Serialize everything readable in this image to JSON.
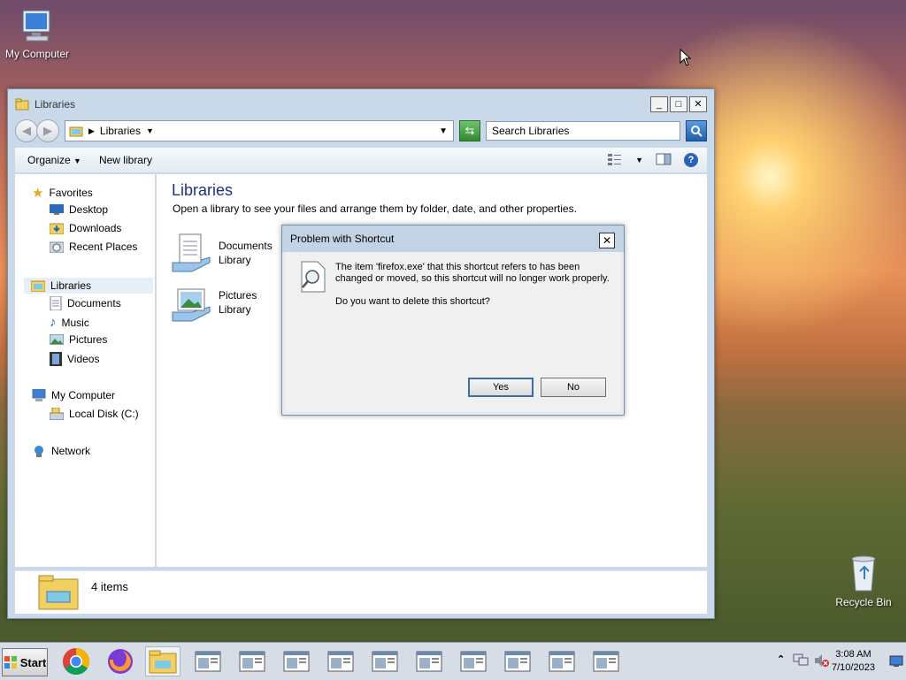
{
  "desktop": {
    "icons": [
      {
        "label": "My Computer"
      },
      {
        "label": "Recycle Bin"
      }
    ]
  },
  "explorer": {
    "title": "Libraries",
    "address": "Libraries",
    "search_placeholder": "Search Libraries",
    "toolbar": {
      "organize": "Organize",
      "new_library": "New library"
    },
    "nav": {
      "favorites": "Favorites",
      "desktop": "Desktop",
      "downloads": "Downloads",
      "recent_places": "Recent Places",
      "libraries": "Libraries",
      "documents": "Documents",
      "music": "Music",
      "pictures": "Pictures",
      "videos": "Videos",
      "my_computer": "My Computer",
      "local_disk": "Local Disk (C:)",
      "network": "Network"
    },
    "heading": "Libraries",
    "subtitle": "Open a library to see your files and arrange them by folder, date, and other properties.",
    "libraries": [
      {
        "line1": "Documents",
        "line2": "Library"
      },
      {
        "line1": "Pictures",
        "line2": "Library"
      }
    ],
    "status": "4 items"
  },
  "dialog": {
    "title": "Problem with Shortcut",
    "message": "The item 'firefox.exe' that this shortcut refers to has been changed or moved, so this shortcut will no longer work properly.",
    "question": "Do you want to delete this shortcut?",
    "yes": "Yes",
    "no": "No"
  },
  "taskbar": {
    "start": "Start",
    "time": "3:08 AM",
    "date": "7/10/2023"
  },
  "colors": {
    "accent": "#1e3287",
    "selection": "#e6eef8"
  }
}
